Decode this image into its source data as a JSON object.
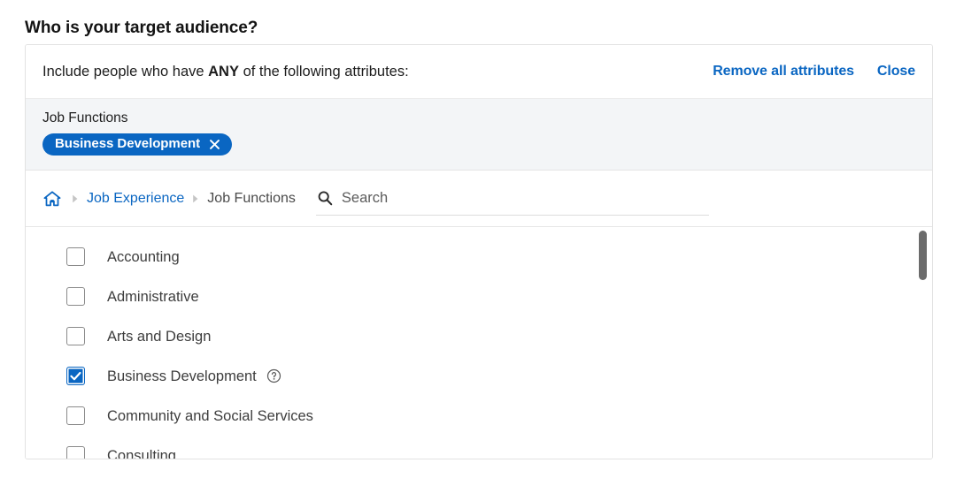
{
  "page": {
    "title": "Who is your target audience?"
  },
  "panel": {
    "header": {
      "prefix": "Include people who have ",
      "emphasis": "ANY",
      "suffix": " of the following attributes:",
      "remove_all_label": "Remove all attributes",
      "close_label": "Close"
    },
    "selected": {
      "group_label": "Job Functions",
      "chips": [
        {
          "label": "Business Development",
          "remove_icon": "close-x-icon"
        }
      ]
    },
    "breadcrumb": {
      "home_icon": "home-icon",
      "separator_icon": "chevron-right-icon",
      "items": [
        {
          "label": "Job Experience",
          "current": false
        },
        {
          "label": "Job Functions",
          "current": true
        }
      ]
    },
    "search": {
      "icon": "search-icon",
      "value": "",
      "placeholder": "Search"
    },
    "options": [
      {
        "label": "Accounting",
        "checked": false,
        "help": false
      },
      {
        "label": "Administrative",
        "checked": false,
        "help": false
      },
      {
        "label": "Arts and Design",
        "checked": false,
        "help": false
      },
      {
        "label": "Business Development",
        "checked": true,
        "help": true,
        "help_icon": "help-circle-icon"
      },
      {
        "label": "Community and Social Services",
        "checked": false,
        "help": false
      },
      {
        "label": "Consulting",
        "checked": false,
        "help": false
      }
    ],
    "scrollbar": {
      "name": "options-scrollbar"
    }
  },
  "colors": {
    "accent": "#0a66c2",
    "band": "#f3f5f7",
    "border": "#e2e2e2",
    "text": "#3d3d3d",
    "title": "#131313",
    "scroll_thumb": "#6b6b6b"
  }
}
